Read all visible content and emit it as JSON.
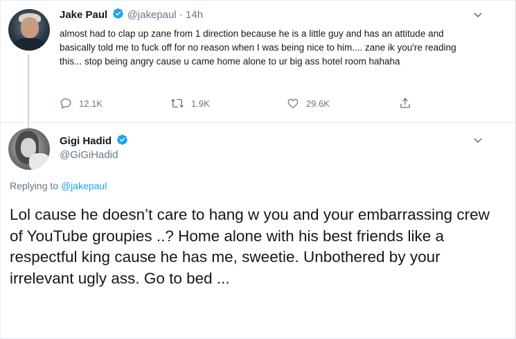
{
  "tweet1": {
    "name": "Jake Paul",
    "handle": "@jakepaul",
    "separator": "·",
    "time": "14h",
    "text": "almost had to clap up zane from 1 direction because he is a little guy and has an attitude and basically told me to fuck off for no reason when I was being nice to him.... zane ik you're reading this... stop being angry cause u came home alone to ur big ass hotel room hahaha",
    "replies": "12.1K",
    "retweets": "1.9K",
    "likes": "29.6K"
  },
  "tweet2": {
    "name": "Gigi Hadid",
    "handle": "@GiGiHadid",
    "replying_prefix": "Replying to",
    "replying_to": "@jakepaul",
    "text": "Lol cause he doesn’t care to hang w you and your embarrassing crew of YouTube groupies ..? Home alone with his best friends like a respectful king cause he has me, sweetie. Unbothered by your irrelevant ugly ass. Go to bed ..."
  },
  "colors": {
    "verified": "#1da1f2",
    "secondary_text": "#657786",
    "link": "#1da1f2"
  },
  "icons": {
    "reply": "reply-icon",
    "retweet": "retweet-icon",
    "like": "heart-icon",
    "share": "share-icon",
    "more": "chevron-down-icon",
    "verified": "verified-badge-icon"
  }
}
